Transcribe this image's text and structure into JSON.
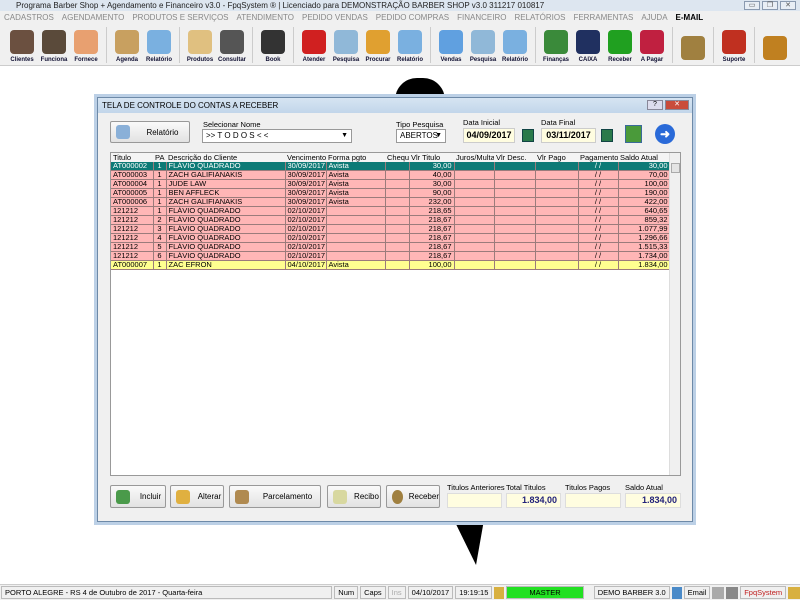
{
  "window": {
    "title": "Programa Barber Shop + Agendamento e Financeiro v3.0 - FpqSystem ® | Licenciado para  DEMONSTRAÇÃO BARBER SHOP v3.0 311217 010817"
  },
  "menu": [
    "CADASTROS",
    "AGENDAMENTO",
    "PRODUTOS E SERVIÇOS",
    "ATENDIMENTO",
    "PEDIDO VENDAS",
    "PEDIDO COMPRAS",
    "FINANCEIRO",
    "RELATÓRIOS",
    "FERRAMENTAS",
    "AJUDA"
  ],
  "menu_email": "E-MAIL",
  "toolbar": [
    {
      "label": "Clientes",
      "color": "#6b5040"
    },
    {
      "label": "Funciona",
      "color": "#5a4a3a"
    },
    {
      "label": "Fornece",
      "color": "#e8a070"
    },
    "sep",
    {
      "label": "Agenda",
      "color": "#c8a060"
    },
    {
      "label": "Relatório",
      "color": "#7ab0e0"
    },
    "sep",
    {
      "label": "Produtos",
      "color": "#e0c080"
    },
    {
      "label": "Consultar",
      "color": "#555"
    },
    "sep",
    {
      "label": "Book",
      "color": "#333"
    },
    "sep",
    {
      "label": "Atender",
      "color": "#d02020"
    },
    {
      "label": "Pesquisa",
      "color": "#90b8d8"
    },
    {
      "label": "Procurar",
      "color": "#e0a030"
    },
    {
      "label": "Relatório",
      "color": "#7ab0e0"
    },
    "sep",
    {
      "label": "Vendas",
      "color": "#60a0e0"
    },
    {
      "label": "Pesquisa",
      "color": "#90b8d8"
    },
    {
      "label": "Relatório",
      "color": "#7ab0e0"
    },
    "sep",
    {
      "label": "Finanças",
      "color": "#3a8a3a"
    },
    {
      "label": "CAIXA",
      "color": "#203060"
    },
    {
      "label": "Receber",
      "color": "#20a020"
    },
    {
      "label": "A Pagar",
      "color": "#c02040"
    },
    "sep",
    {
      "label": "",
      "color": "#a08040"
    },
    "sep",
    {
      "label": "Suporte",
      "color": "#c03020"
    },
    "sep",
    {
      "label": "",
      "color": "#c08020"
    }
  ],
  "dialog": {
    "title": "TELA DE CONTROLE DO CONTAS A RECEBER",
    "relatorio": "Relatório",
    "select_name_label": "Selecionar Nome",
    "select_name_value": ">> T O D O S < <",
    "tipo_label": "Tipo  Pesquisa",
    "tipo_value": "ABERTOS",
    "data_inicial_label": "Data Inicial",
    "data_inicial": "04/09/2017",
    "data_final_label": "Data Final",
    "data_final": "03/11/2017",
    "columns": [
      "Titulo",
      "PA",
      "Descrição do Cliente",
      "Vencimento",
      "Forma pgto",
      "Cheque",
      "Vlr Titulo",
      "Juros/Multa",
      "Vlr Desc.",
      "Vlr Pago",
      "Pagamento",
      "Saldo Atual"
    ],
    "rows": [
      {
        "style": "s",
        "cells": [
          "AT000002",
          "1",
          "FLÁVIO QUADRADO",
          "30/09/2017",
          "Avista",
          "",
          "30,00",
          "",
          "",
          "",
          "/ /",
          "30,00"
        ]
      },
      {
        "style": "p",
        "cells": [
          "AT000003",
          "1",
          "ZACH GALIFIANAKIS",
          "30/09/2017",
          "Avista",
          "",
          "40,00",
          "",
          "",
          "",
          "/ /",
          "70,00"
        ]
      },
      {
        "style": "p",
        "cells": [
          "AT000004",
          "1",
          "JUDE LAW",
          "30/09/2017",
          "Avista",
          "",
          "30,00",
          "",
          "",
          "",
          "/ /",
          "100,00"
        ]
      },
      {
        "style": "p",
        "cells": [
          "AT000005",
          "1",
          "BEN AFFLECK",
          "30/09/2017",
          "Avista",
          "",
          "90,00",
          "",
          "",
          "",
          "/ /",
          "190,00"
        ]
      },
      {
        "style": "p",
        "cells": [
          "AT000006",
          "1",
          "ZACH GALIFIANAKIS",
          "30/09/2017",
          "Avista",
          "",
          "232,00",
          "",
          "",
          "",
          "/ /",
          "422,00"
        ]
      },
      {
        "style": "p",
        "cells": [
          "121212",
          "1",
          "FLÁVIO QUADRADO",
          "02/10/2017",
          "",
          "",
          "218,65",
          "",
          "",
          "",
          "/ /",
          "640,65"
        ]
      },
      {
        "style": "p",
        "cells": [
          "121212",
          "2",
          "FLÁVIO QUADRADO",
          "02/10/2017",
          "",
          "",
          "218,67",
          "",
          "",
          "",
          "/ /",
          "859,32"
        ]
      },
      {
        "style": "p",
        "cells": [
          "121212",
          "3",
          "FLÁVIO QUADRADO",
          "02/10/2017",
          "",
          "",
          "218,67",
          "",
          "",
          "",
          "/ /",
          "1.077,99"
        ]
      },
      {
        "style": "p",
        "cells": [
          "121212",
          "4",
          "FLÁVIO QUADRADO",
          "02/10/2017",
          "",
          "",
          "218,67",
          "",
          "",
          "",
          "/ /",
          "1.296,66"
        ]
      },
      {
        "style": "p",
        "cells": [
          "121212",
          "5",
          "FLÁVIO QUADRADO",
          "02/10/2017",
          "",
          "",
          "218,67",
          "",
          "",
          "",
          "/ /",
          "1.515,33"
        ]
      },
      {
        "style": "p",
        "cells": [
          "121212",
          "6",
          "FLÁVIO QUADRADO",
          "02/10/2017",
          "",
          "",
          "218,67",
          "",
          "",
          "",
          "/ /",
          "1.734,00"
        ]
      },
      {
        "style": "y",
        "cells": [
          "AT000007",
          "1",
          "ZAC EFRON",
          "04/10/2017",
          "Avista",
          "",
          "100,00",
          "",
          "",
          "",
          "/ /",
          "1.834,00"
        ]
      }
    ],
    "buttons": {
      "incluir": "Incluir",
      "alterar": "Alterar",
      "parcelamento": "Parcelamento",
      "recibo": "Recibo",
      "receber": "Receber"
    },
    "summary": {
      "anteriores_label": "Titulos Anteriores",
      "anteriores": "",
      "total_label": "Total Titulos",
      "total": "1.834,00",
      "pagos_label": "Titulos Pagos",
      "pagos": "",
      "saldo_label": "Saldo Atual",
      "saldo": "1.834,00"
    }
  },
  "status": {
    "location": "PORTO ALEGRE - RS  4 de Outubro de 2017 - Quarta-feira",
    "num": "Num",
    "caps": "Caps",
    "ins": "Ins",
    "date": "04/10/2017",
    "time": "19:19:15",
    "user": "MASTER",
    "db": "DEMO BARBER 3.0",
    "email": "Email",
    "brand": "FpqSystem"
  }
}
